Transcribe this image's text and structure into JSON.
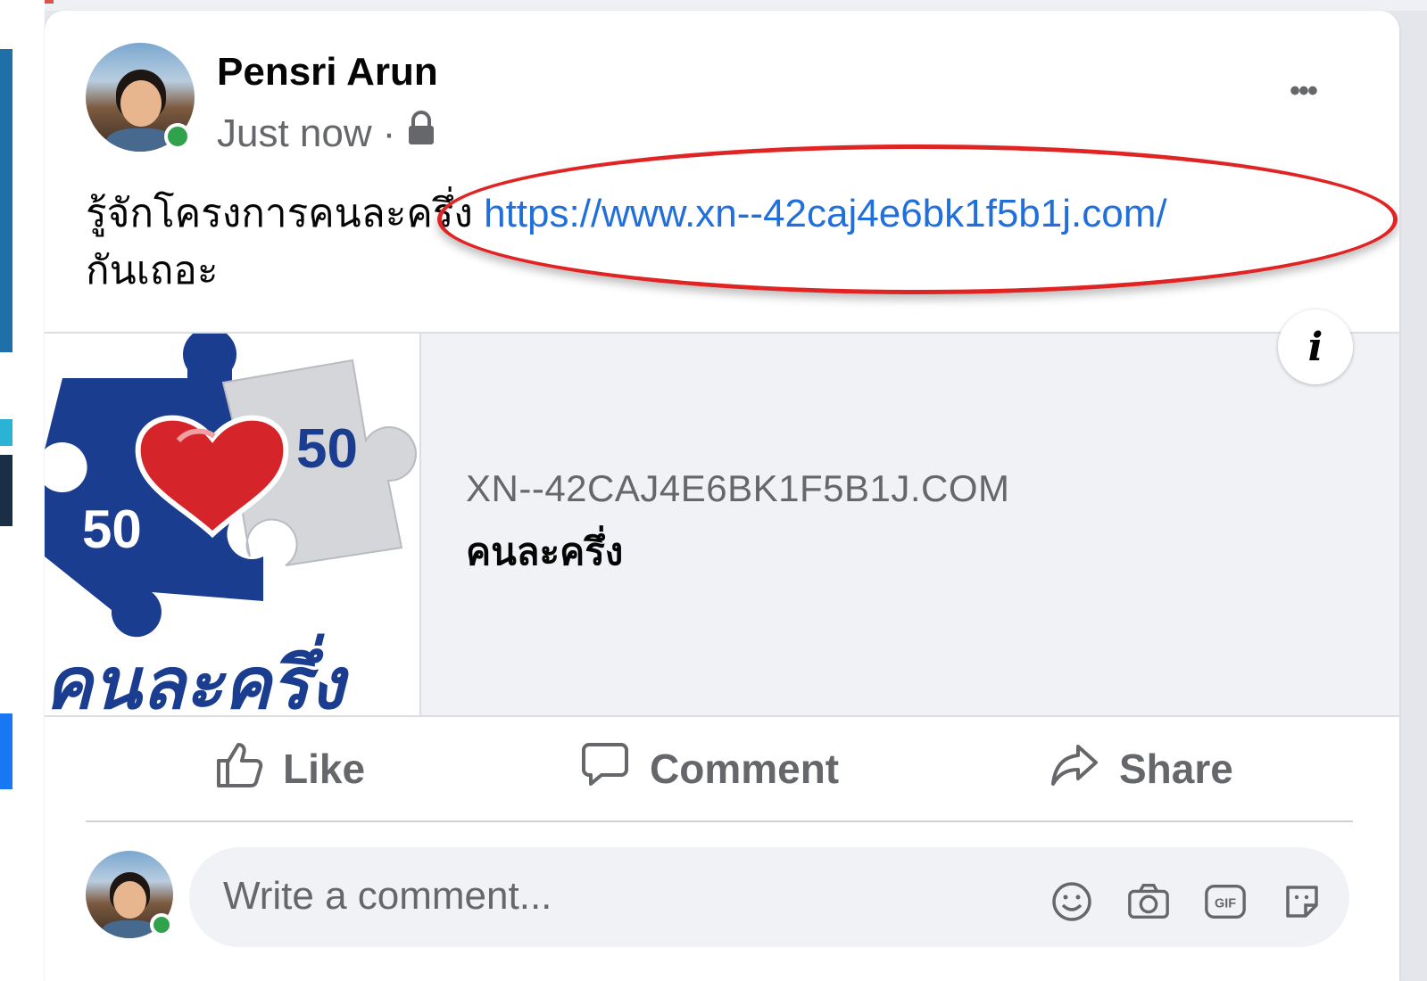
{
  "post": {
    "author": "Pensri Arun",
    "timestamp": "Just now",
    "separator": "·",
    "privacy_icon": "lock-icon",
    "text_before_link": "รู้จักโครงการคนละครึ่ง ",
    "link": "https://www.xn--42caj4e6bk1f5b1j.com/",
    "text_after_link": "กันเถอะ",
    "more_icon": "more-options-icon",
    "more_label": "•••"
  },
  "link_preview": {
    "domain": "XN--42CAJ4E6BK1F5B1J.COM",
    "title": "คนละครึ่ง",
    "thumb_number_1": "50",
    "thumb_number_2": "50",
    "thumb_logo_text": "คนละครึ่ง",
    "info_label": "i"
  },
  "actions": {
    "like": "Like",
    "comment": "Comment",
    "share": "Share"
  },
  "comment_composer": {
    "placeholder": "Write a comment...",
    "icons": [
      "emoji-icon",
      "camera-icon",
      "gif-icon",
      "sticker-icon"
    ]
  },
  "colors": {
    "link": "#216fdb",
    "annotation": "#e02424",
    "online": "#31a24c",
    "secondary_text": "#65676b"
  }
}
